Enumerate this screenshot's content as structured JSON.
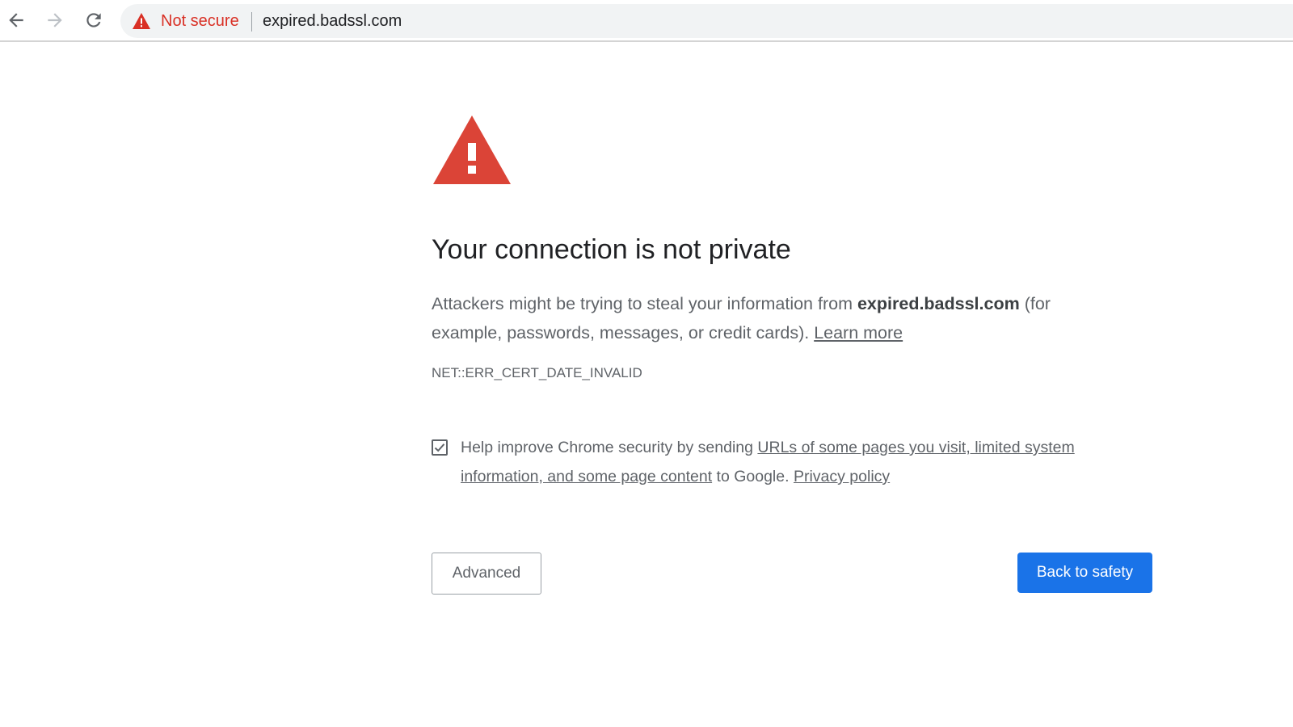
{
  "colors": {
    "danger": "#d93025",
    "warning_triangle": "#db4437",
    "primary_button": "#1a73e8",
    "text_secondary": "#5f6368",
    "omnibox_bg": "#f1f3f4"
  },
  "toolbar": {
    "back_icon": "arrow-left-icon",
    "forward_icon": "arrow-right-icon",
    "reload_icon": "reload-icon",
    "security_icon": "warning-triangle-icon",
    "security_label": "Not secure",
    "url": "expired.badssl.com"
  },
  "interstitial": {
    "icon": "warning-triangle-icon",
    "heading": "Your connection is not private",
    "explanation_pre": "Attackers might be trying to steal your information from ",
    "explanation_host": "expired.badssl.com",
    "explanation_post": " (for example, passwords, messages, or credit cards). ",
    "learn_more": "Learn more",
    "error_code": "NET::ERR_CERT_DATE_INVALID",
    "checkbox": {
      "checked": true,
      "text_pre": "Help improve Chrome security by sending ",
      "link_text": "URLs of some pages you visit, limited system information, and some page content",
      "text_mid": " to Google. ",
      "privacy_link": "Privacy policy"
    },
    "advanced_button": "Advanced",
    "back_button": "Back to safety"
  }
}
